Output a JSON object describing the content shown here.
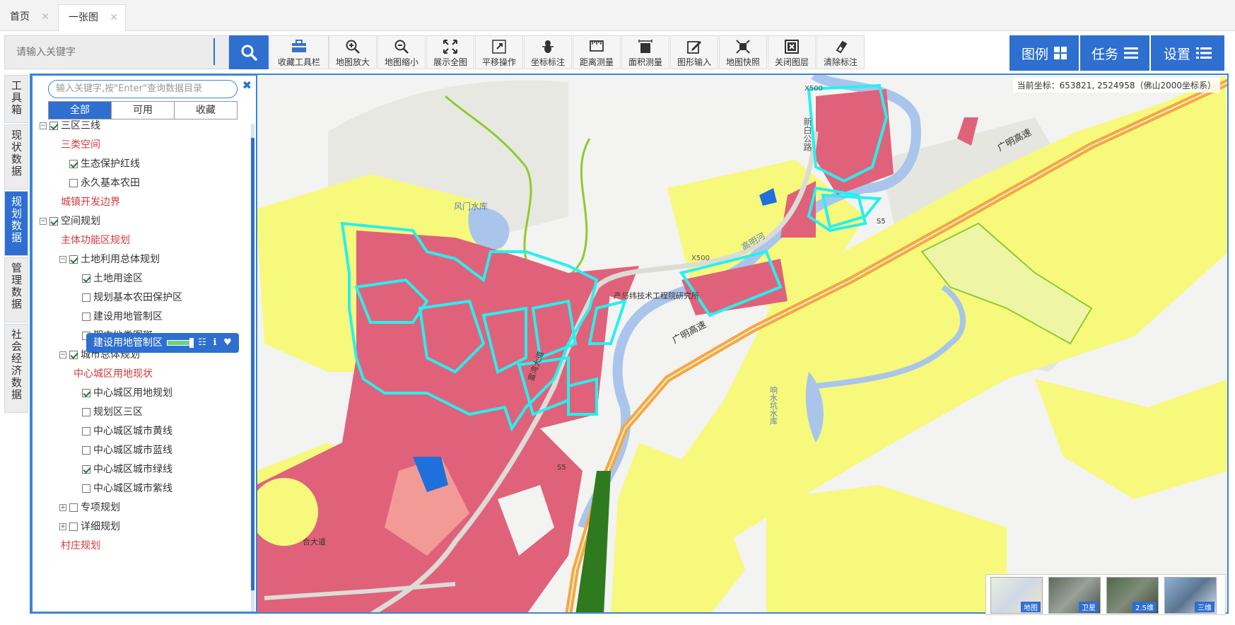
{
  "tabs": [
    {
      "label": "首页",
      "close": "✕"
    },
    {
      "label": "一张图",
      "close": "✕"
    }
  ],
  "search": {
    "placeholder": "请输入关键字"
  },
  "toolbar": [
    {
      "label": "收藏工具栏",
      "icon": "toolbox-icon"
    },
    {
      "label": "地图放大",
      "icon": "zoom-in-icon"
    },
    {
      "label": "地图缩小",
      "icon": "zoom-out-icon"
    },
    {
      "label": "展示全图",
      "icon": "full-extent-icon"
    },
    {
      "label": "平移操作",
      "icon": "pan-icon"
    },
    {
      "label": "坐标标注",
      "icon": "coordinate-marker-icon"
    },
    {
      "label": "距离测量",
      "icon": "ruler-icon"
    },
    {
      "label": "面积测量",
      "icon": "area-measure-icon"
    },
    {
      "label": "图形输入",
      "icon": "draw-icon"
    },
    {
      "label": "地图快照",
      "icon": "snapshot-icon"
    },
    {
      "label": "关闭图层",
      "icon": "close-layer-icon"
    },
    {
      "label": "清除标注",
      "icon": "eraser-icon"
    }
  ],
  "right_buttons": [
    {
      "label": "图例",
      "icon": "grid-icon"
    },
    {
      "label": "任务",
      "icon": "list-icon"
    },
    {
      "label": "设置",
      "icon": "settings-list-icon"
    }
  ],
  "side_tabs": [
    {
      "label": "工具箱"
    },
    {
      "label": "现状数据"
    },
    {
      "label": "规划数据",
      "active": true
    },
    {
      "label": "管理数据"
    },
    {
      "label": "社会经济数据"
    }
  ],
  "panel": {
    "search_placeholder": "输入关键字,按\"Enter\"查询数据目录",
    "close": "✖",
    "filters": [
      "全部",
      "可用",
      "收藏"
    ],
    "tree": [
      {
        "label": "三区三线",
        "level": 0,
        "expander": "−",
        "checkbox": true,
        "checked": true,
        "red": false
      },
      {
        "label": "三类空间",
        "level": 1,
        "checkbox": false,
        "red": true
      },
      {
        "label": "生态保护红线",
        "level": 1,
        "checkbox": true,
        "checked": true,
        "red": false
      },
      {
        "label": "永久基本农田",
        "level": 1,
        "checkbox": true,
        "checked": false,
        "red": false
      },
      {
        "label": "城镇开发边界",
        "level": 1,
        "checkbox": false,
        "red": true
      },
      {
        "label": "空间规划",
        "level": 0,
        "expander": "−",
        "checkbox": true,
        "checked": true,
        "red": false
      },
      {
        "label": "主体功能区规划",
        "level": 1,
        "checkbox": false,
        "red": true
      },
      {
        "label": "土地利用总体规划",
        "level": 1,
        "expander": "−",
        "checkbox": true,
        "checked": true,
        "red": false
      },
      {
        "label": "土地用途区",
        "level": 2,
        "checkbox": true,
        "checked": true,
        "red": false
      },
      {
        "label": "规划基本农田保护区",
        "level": 2,
        "checkbox": true,
        "checked": false,
        "red": false
      },
      {
        "label": "建设用地管制区",
        "level": 2,
        "checkbox": true,
        "checked": false,
        "red": false,
        "hover": true
      },
      {
        "label": "期末地类图斑",
        "level": 2,
        "checkbox": true,
        "checked": false,
        "red": false
      },
      {
        "label": "城市总体规划",
        "level": 1,
        "expander": "−",
        "checkbox": true,
        "checked": true,
        "red": false
      },
      {
        "label": "中心城区用地现状",
        "level": 2,
        "checkbox": false,
        "red": true
      },
      {
        "label": "中心城区用地规划",
        "level": 2,
        "checkbox": true,
        "checked": true,
        "red": false
      },
      {
        "label": "规划区三区",
        "level": 2,
        "checkbox": true,
        "checked": false,
        "red": false
      },
      {
        "label": "中心城区城市黄线",
        "level": 2,
        "checkbox": true,
        "checked": false,
        "red": false
      },
      {
        "label": "中心城区城市蓝线",
        "level": 2,
        "checkbox": true,
        "checked": false,
        "red": false
      },
      {
        "label": "中心城区城市绿线",
        "level": 2,
        "checkbox": true,
        "checked": true,
        "red": false
      },
      {
        "label": "中心城区城市紫线",
        "level": 2,
        "checkbox": true,
        "checked": false,
        "red": false
      },
      {
        "label": "专项规划",
        "level": 1,
        "expander": "+",
        "checkbox": true,
        "checked": false,
        "red": false
      },
      {
        "label": "详细规划",
        "level": 1,
        "expander": "+",
        "checkbox": true,
        "checked": false,
        "red": false
      },
      {
        "label": "村庄规划",
        "level": 1,
        "checkbox": false,
        "red": true
      }
    ],
    "hover_icons": [
      "opacity-slider",
      "table-icon",
      "info-icon",
      "heart-icon"
    ]
  },
  "map": {
    "coordinate_readout": "当前坐标：653821, 2524958（佛山2000坐标系）",
    "labels": [
      "X500",
      "新白公路",
      "广明高速",
      "S5",
      "风门水库",
      "X500",
      "高明河",
      "产与纬技术工程院研究所",
      "广明高速",
      "响水坑水库",
      "S5",
      "富湾大道",
      "合大道"
    ],
    "colors": {
      "construction": "#e0627a",
      "green_space": "#f7f97c",
      "forest": "#e3e3dd",
      "water": "#a9c5ec",
      "highway": "#f5a941",
      "boundary": "#26f0f0",
      "greenline": "#8dcb2e",
      "blue_parcel": "#1f6fdc",
      "salmon": "#f29b96"
    }
  },
  "basemaps": [
    {
      "label": "地图"
    },
    {
      "label": "卫星"
    },
    {
      "label": "2.5维"
    },
    {
      "label": "三维"
    }
  ]
}
